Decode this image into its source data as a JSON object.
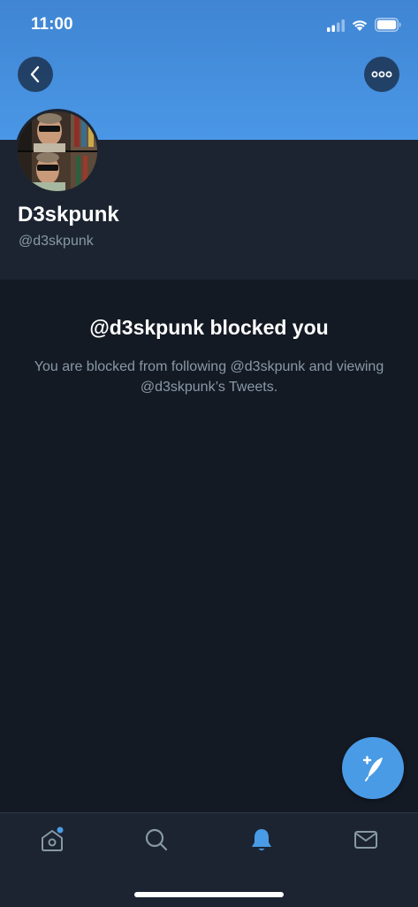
{
  "status_bar": {
    "time": "11:00"
  },
  "header": {
    "back_icon": "chevron-left-icon",
    "more_icon": "more-horizontal-icon"
  },
  "profile": {
    "display_name": "D3skpunk",
    "handle": "@d3skpunk"
  },
  "blocked": {
    "title": "@d3skpunk blocked you",
    "description": "You are blocked from following @d3skpunk and viewing @d3skpunk’s Tweets."
  },
  "tabs": [
    {
      "name": "home",
      "icon": "home-icon",
      "has_badge": true
    },
    {
      "name": "search",
      "icon": "search-icon"
    },
    {
      "name": "notifications",
      "icon": "bell-icon",
      "active": true
    },
    {
      "name": "messages",
      "icon": "mail-icon"
    }
  ],
  "fab": {
    "icon": "compose-tweet-icon"
  },
  "colors": {
    "accent": "#4a9be6",
    "background": "#141a24",
    "surface": "#1c2431",
    "muted_text": "#8899a6"
  }
}
